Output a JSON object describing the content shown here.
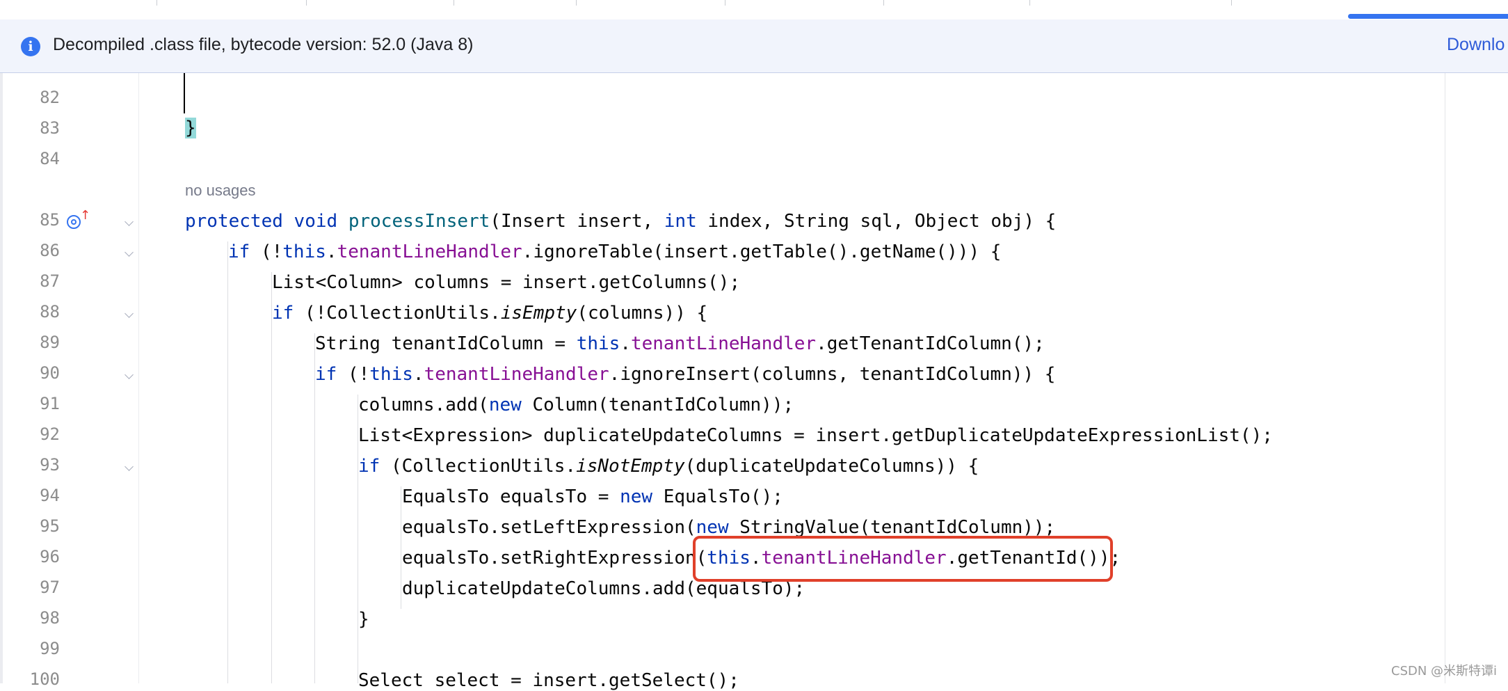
{
  "banner": {
    "icon": "info-icon",
    "message": "Decompiled .class file, bytecode version: 52.0 (Java 8)",
    "link": "Downlo"
  },
  "gutter": {
    "line_numbers": [
      "82",
      "83",
      "84",
      "85",
      "86",
      "87",
      "88",
      "89",
      "90",
      "91",
      "92",
      "93",
      "94",
      "95",
      "96",
      "97",
      "98",
      "99",
      "100"
    ]
  },
  "editor": {
    "brace_83": "}",
    "usage_hint": "no usages",
    "lines": {
      "l85": {
        "kw1": "protected",
        "kw2": "void",
        "name": "processInsert",
        "a": "(Insert insert, ",
        "kw3": "int",
        "b": " index, String sql, Object obj) {"
      },
      "l86": {
        "kw1": "if",
        "a": " (!",
        "kw2": "this",
        "b": ".",
        "fld": "tenantLineHandler",
        "c": ".ignoreTable(insert.getTable().getName())) {"
      },
      "l87": {
        "a": "List<Column> columns = insert.getColumns();"
      },
      "l88": {
        "kw1": "if",
        "a": " (!CollectionUtils.",
        "it": "isEmpty",
        "b": "(columns)) {"
      },
      "l89": {
        "a": "String tenantIdColumn = ",
        "kw1": "this",
        "b": ".",
        "fld": "tenantLineHandler",
        "c": ".getTenantIdColumn();"
      },
      "l90": {
        "kw1": "if",
        "a": " (!",
        "kw2": "this",
        "b": ".",
        "fld": "tenantLineHandler",
        "c": ".ignoreInsert(columns, tenantIdColumn)) {"
      },
      "l91": {
        "a": "columns.add(",
        "kw1": "new",
        "b": " Column(tenantIdColumn));"
      },
      "l92": {
        "a": "List<Expression> duplicateUpdateColumns = insert.getDuplicateUpdateExpressionList();"
      },
      "l93": {
        "kw1": "if",
        "a": " (CollectionUtils.",
        "it": "isNotEmpty",
        "b": "(duplicateUpdateColumns)) {"
      },
      "l94": {
        "a": "EqualsTo equalsTo = ",
        "kw1": "new",
        "b": " EqualsTo();"
      },
      "l95": {
        "a": "equalsTo.setLeftExpression(",
        "kw1": "new",
        "b": " StringValue(tenantIdColumn));"
      },
      "l96": {
        "a": "equalsTo.setRightExpression(",
        "kw1": "this",
        "b": ".",
        "fld": "tenantLineHandler",
        "c": ".getTenantId());"
      },
      "l97": {
        "a": "duplicateUpdateColumns.add(equalsTo);"
      },
      "l98": {
        "a": "}"
      },
      "l100": {
        "a": "Select select = insert.getSelect();"
      }
    }
  },
  "watermark": "CSDN @米斯特谭i",
  "colors": {
    "keyword": "#0033b3",
    "field": "#871094",
    "method": "#00627a",
    "highlight_box": "#e0402a"
  }
}
